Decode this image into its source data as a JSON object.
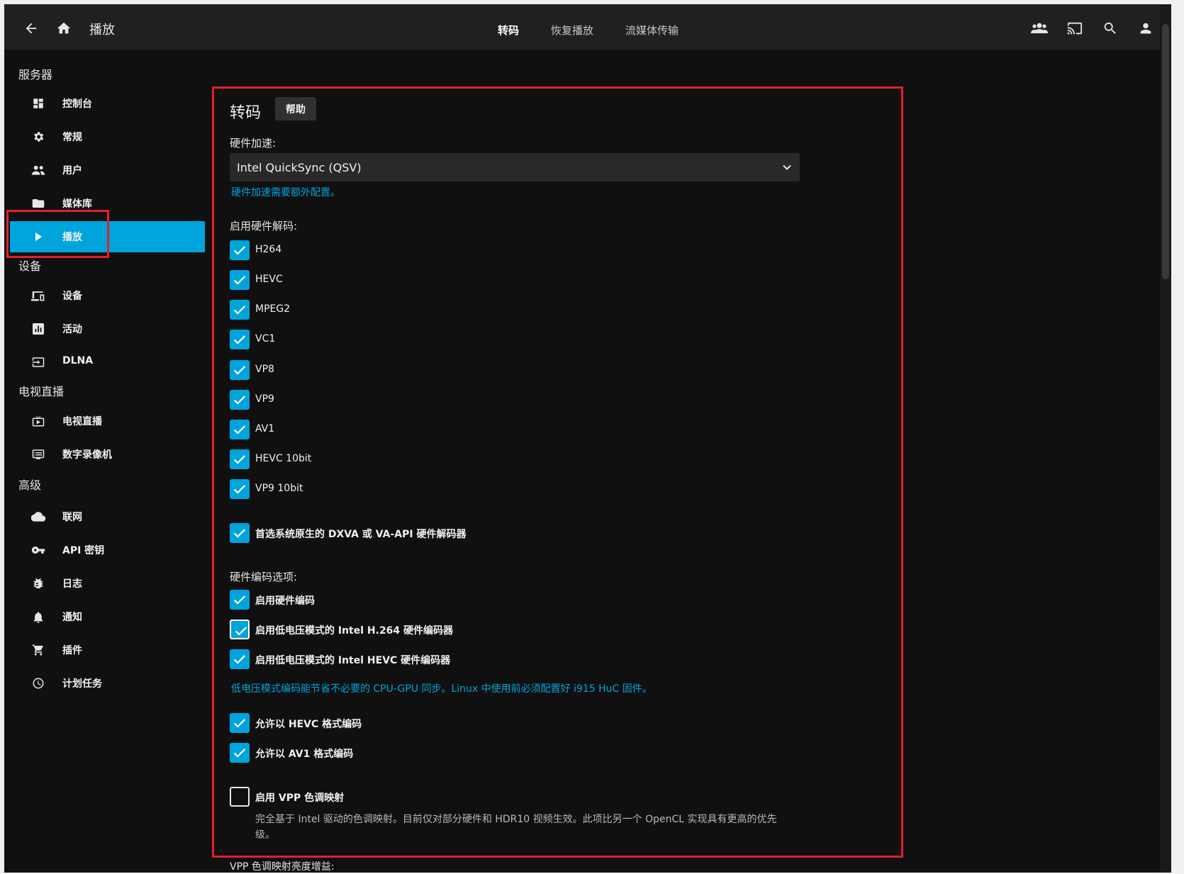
{
  "header": {
    "title": "播放",
    "tabs": [
      {
        "label": "转码",
        "active": true
      },
      {
        "label": "恢复播放",
        "active": false
      },
      {
        "label": "流媒体传输",
        "active": false
      }
    ],
    "icons": [
      "back-arrow-icon",
      "home-icon",
      "users-icon",
      "cast-icon",
      "search-icon",
      "user-icon"
    ]
  },
  "sidebar": {
    "sections": [
      {
        "title": "服务器",
        "items": [
          {
            "label": "控制台",
            "icon": "dashboard-icon"
          },
          {
            "label": "常规",
            "icon": "gear-icon"
          },
          {
            "label": "用户",
            "icon": "people-icon"
          },
          {
            "label": "媒体库",
            "icon": "folder-icon"
          },
          {
            "label": "播放",
            "icon": "play-icon",
            "active": true
          }
        ]
      },
      {
        "title": "设备",
        "items": [
          {
            "label": "设备",
            "icon": "devices-icon"
          },
          {
            "label": "活动",
            "icon": "chart-icon"
          },
          {
            "label": "DLNA",
            "icon": "input-icon"
          }
        ]
      },
      {
        "title": "电视直播",
        "items": [
          {
            "label": "电视直播",
            "icon": "live-tv-icon"
          },
          {
            "label": "数字录像机",
            "icon": "dvr-icon"
          }
        ]
      },
      {
        "title": "高级",
        "items": [
          {
            "label": "联网",
            "icon": "cloud-icon"
          },
          {
            "label": "API 密钥",
            "icon": "key-icon"
          },
          {
            "label": "日志",
            "icon": "bug-icon"
          },
          {
            "label": "通知",
            "icon": "bell-icon"
          },
          {
            "label": "插件",
            "icon": "cart-icon"
          },
          {
            "label": "计划任务",
            "icon": "clock-icon"
          }
        ]
      }
    ]
  },
  "main": {
    "title": "转码",
    "help_label": "帮助",
    "hw_accel_label": "硬件加速:",
    "hw_accel_value": "Intel QuickSync (QSV)",
    "hw_accel_link": "硬件加速需要额外配置。",
    "decode_label": "启用硬件解码:",
    "decode_codecs": [
      {
        "label": "H264",
        "checked": true
      },
      {
        "label": "HEVC",
        "checked": true
      },
      {
        "label": "MPEG2",
        "checked": true
      },
      {
        "label": "VC1",
        "checked": true
      },
      {
        "label": "VP8",
        "checked": true
      },
      {
        "label": "VP9",
        "checked": true
      },
      {
        "label": "AV1",
        "checked": true
      },
      {
        "label": "HEVC 10bit",
        "checked": true
      },
      {
        "label": "VP9 10bit",
        "checked": true
      }
    ],
    "prefer_native": {
      "label": "首选系统原生的 DXVA 或 VA-API 硬件解码器",
      "checked": true
    },
    "encode_label": "硬件编码选项:",
    "encode_options": [
      {
        "label": "启用硬件编码",
        "checked": true
      },
      {
        "label": "启用低电压模式的 Intel H.264 硬件编码器",
        "checked": true
      },
      {
        "label": "启用低电压模式的 Intel HEVC 硬件编码器",
        "checked": true
      }
    ],
    "low_power_link": "低电压模式编码能节省不必要的 CPU-GPU 同步。Linux 中使用前必须配置好 i915 HuC 固件。",
    "allow_options": [
      {
        "label": "允许以 HEVC 格式编码",
        "checked": true
      },
      {
        "label": "允许以 AV1 格式编码",
        "checked": true
      }
    ],
    "vpp": {
      "label": "启用 VPP 色调映射",
      "checked": false,
      "description": "完全基于 Intel 驱动的色调映射。目前仅对部分硬件和 HDR10 视频生效。此项比另一个 OpenCL 实现具有更高的优先级。"
    },
    "vpp_brightness_label": "VPP 色调映射亮度增益:"
  },
  "colors": {
    "accent": "#00a4dc",
    "highlight": "#e0202e",
    "background": "#101010"
  }
}
